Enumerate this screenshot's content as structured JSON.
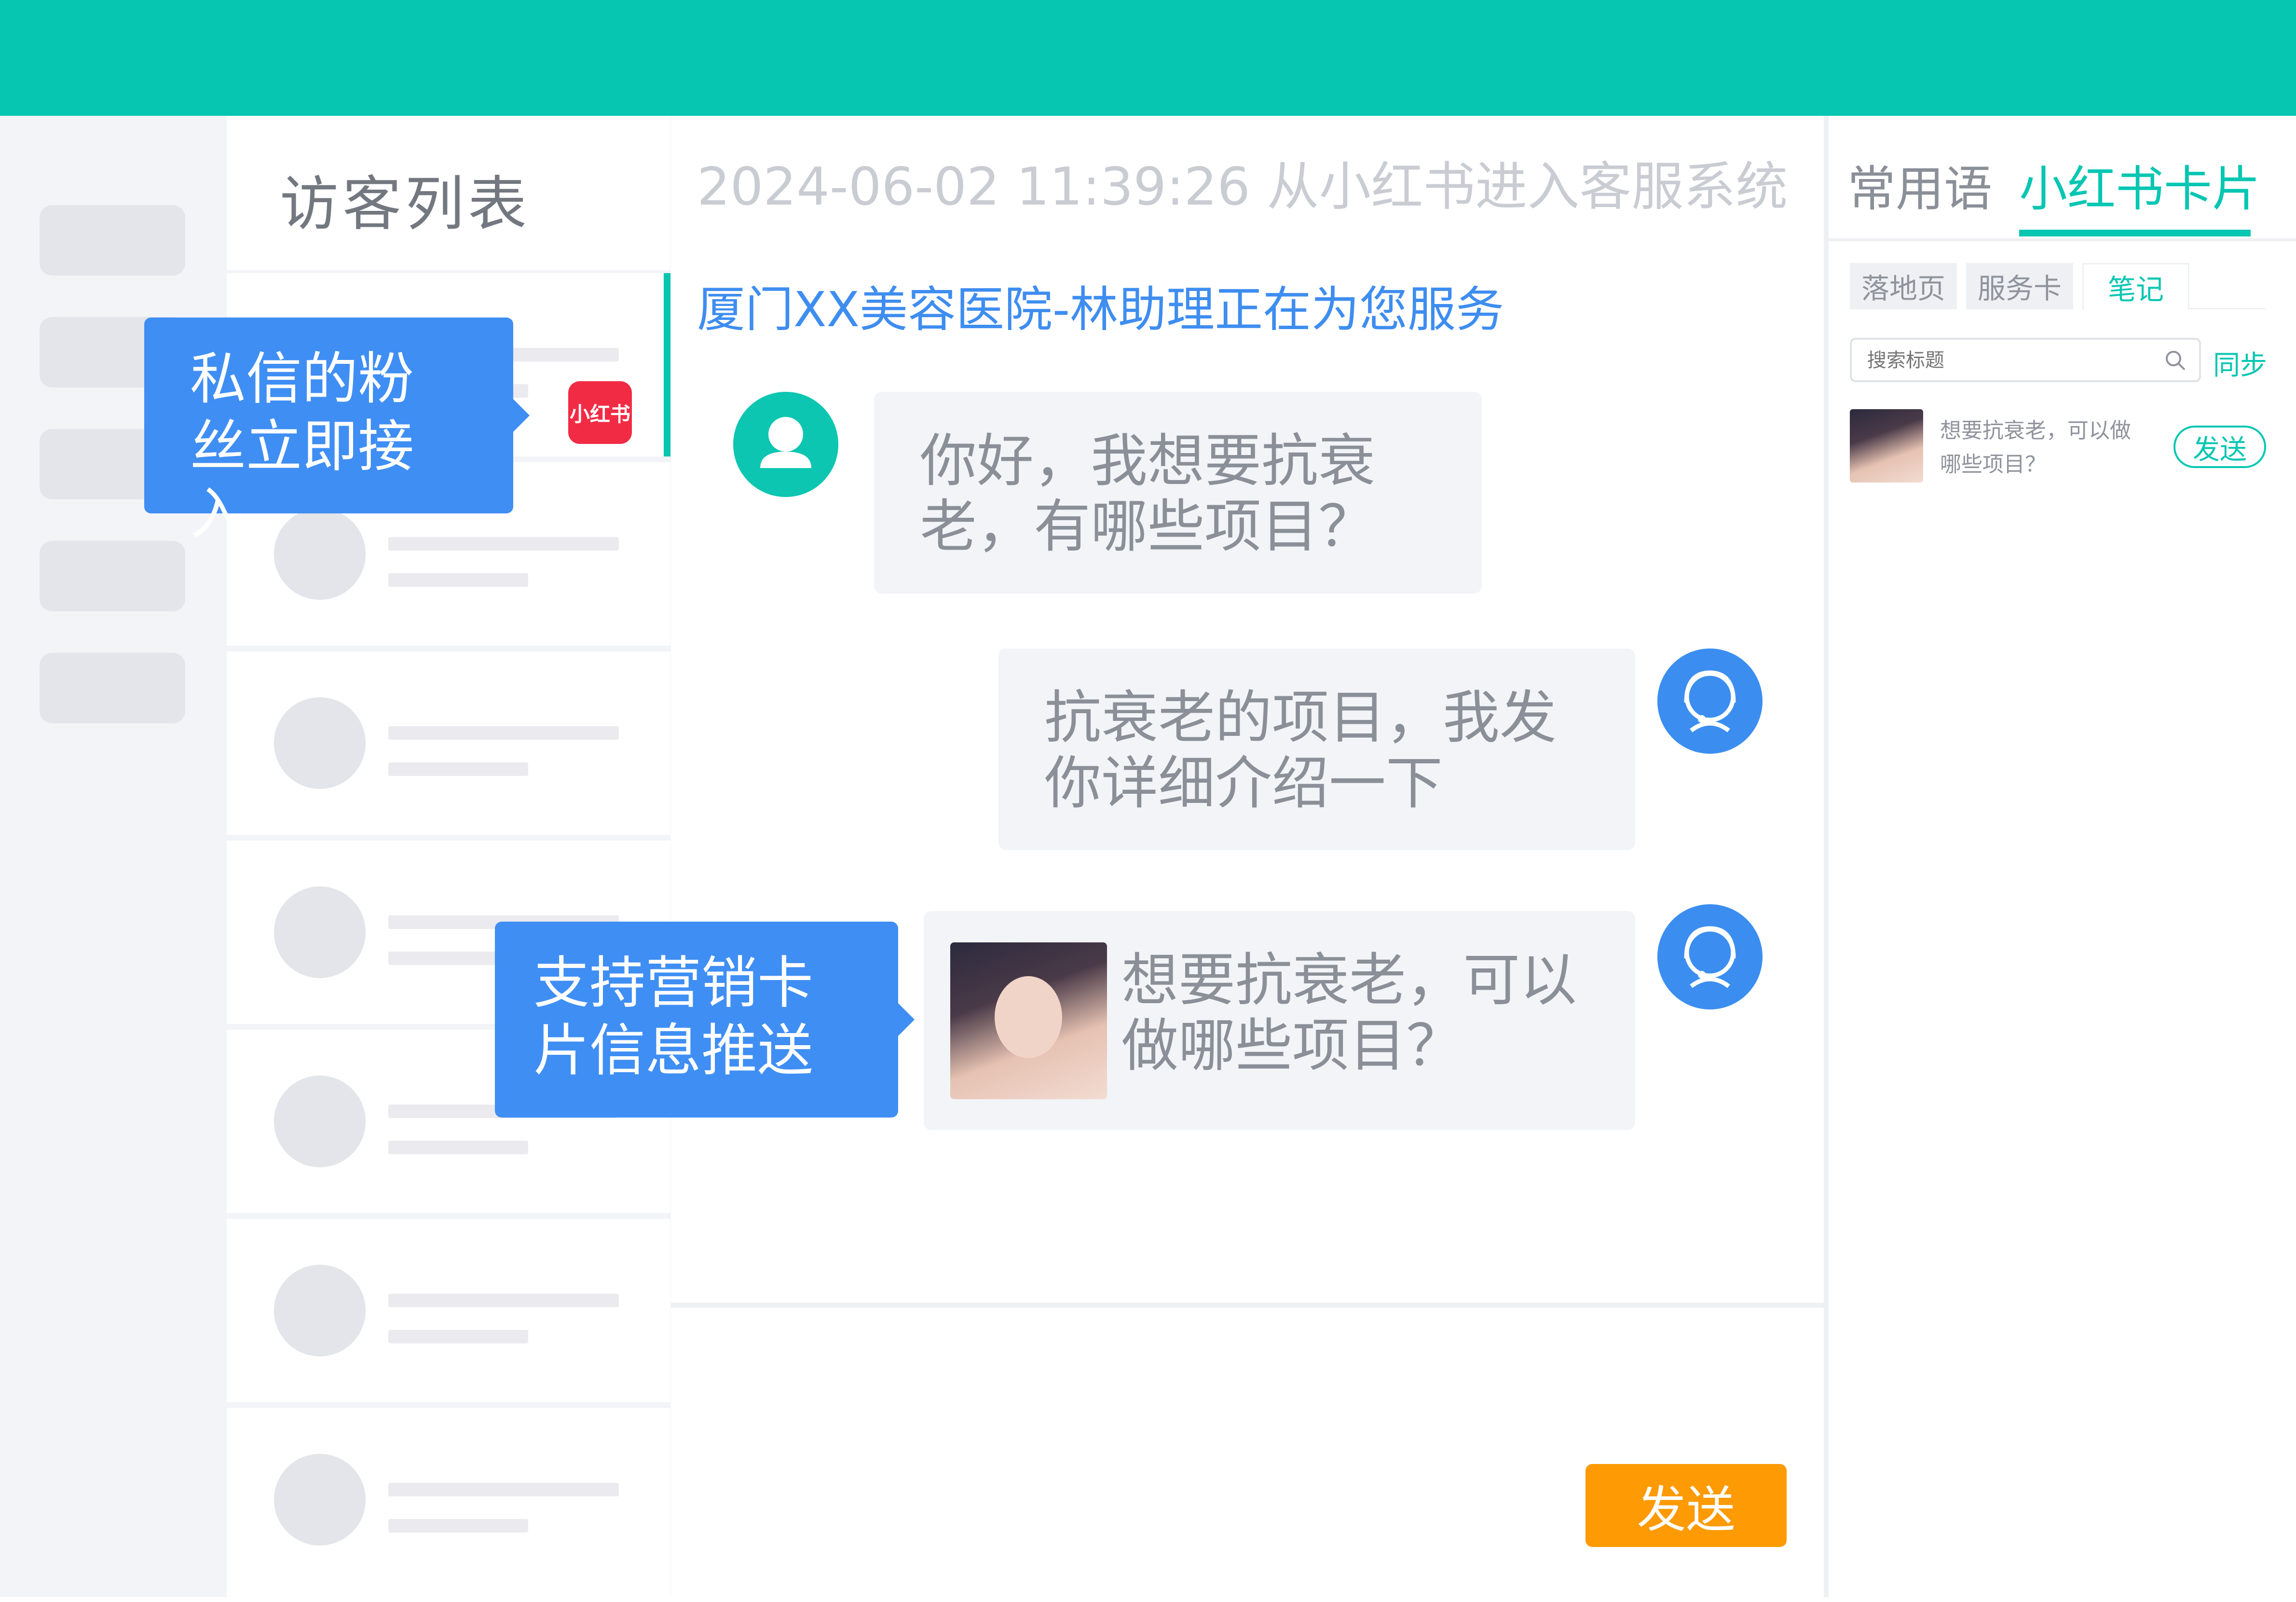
{
  "header": {
    "color": "#06c6b2"
  },
  "visitor_list": {
    "title": "访客列表"
  },
  "sidebar_badge": {
    "label": "小红书",
    "color": "#f22b44"
  },
  "chat": {
    "system_line": "2024-06-02  11:39:26 从小红书进入客服系统",
    "service_line": "厦门XX美容医院-林助理正在为您服务",
    "messages": [
      {
        "role": "visitor",
        "text": "你好，我想要抗衰老，有哪些项目？"
      },
      {
        "role": "agent",
        "text": "抗衰老的项目，我发你详细介绍一下"
      },
      {
        "role": "agent",
        "type": "card",
        "text": "想要抗衰老，可以做哪些项目？"
      }
    ],
    "send_label": "发送",
    "send_color": "#fd9a04"
  },
  "tooltips": {
    "fan_dm": "私信的粉丝立即接入",
    "card_push": "支持营销卡片信息推送"
  },
  "right_panel": {
    "tabs": [
      "常用语",
      "小红书卡片"
    ],
    "active_tab": "小红书卡片",
    "subtabs": [
      "落地页",
      "服务卡",
      "笔记"
    ],
    "active_subtab": "笔记",
    "search_placeholder": "搜索标题",
    "sync_label": "同步",
    "card": {
      "text": "想要抗衰老，可以做哪些项目？",
      "send_label": "发送"
    }
  },
  "accent_color": "#06c6b2",
  "tooltip_color": "#3f8ef4"
}
